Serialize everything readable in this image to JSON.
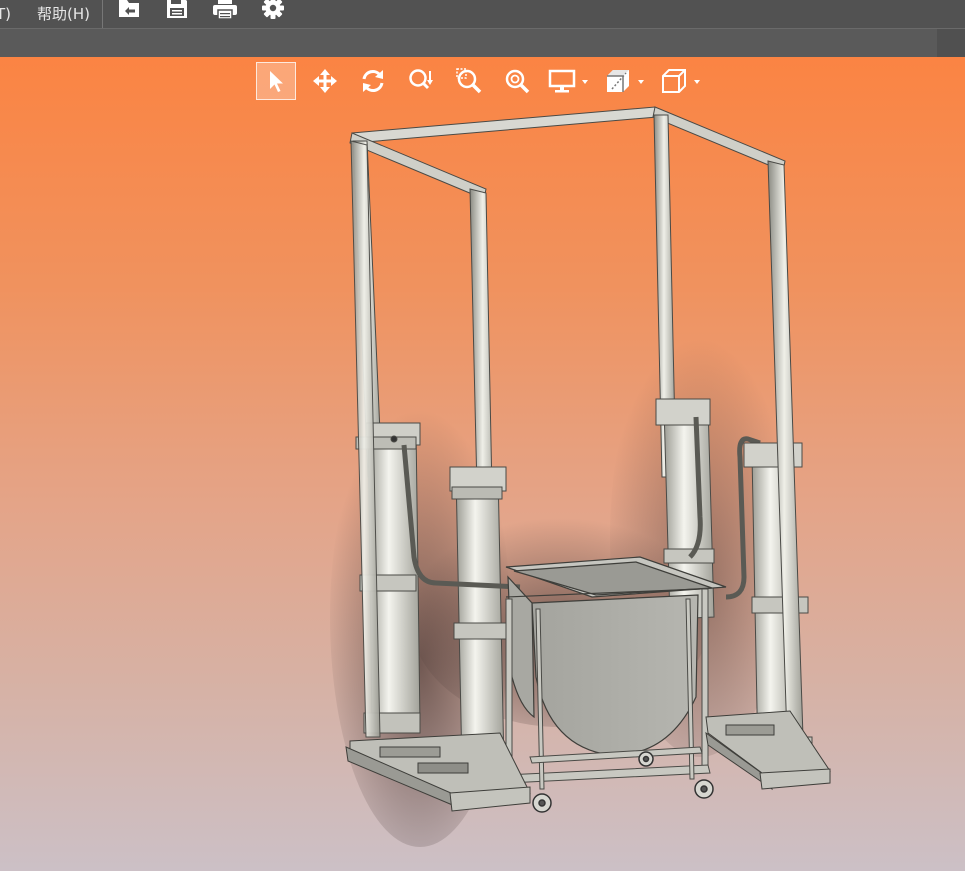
{
  "menubar": {
    "items": [
      {
        "label": "T)"
      },
      {
        "label": "帮助(H)"
      }
    ],
    "tools": [
      {
        "icon": "import-icon"
      },
      {
        "icon": "save-icon"
      },
      {
        "icon": "print-icon"
      },
      {
        "icon": "gear-icon"
      }
    ]
  },
  "view_toolbar": {
    "buttons": [
      {
        "icon": "select-arrow-icon",
        "active": true
      },
      {
        "icon": "pan-icon"
      },
      {
        "icon": "rotate-icon"
      },
      {
        "icon": "zoom-dynamic-icon"
      },
      {
        "icon": "zoom-window-icon"
      },
      {
        "icon": "zoom-fit-icon"
      },
      {
        "icon": "display-mode-icon",
        "dropdown": true
      },
      {
        "icon": "section-view-icon",
        "dropdown": true
      },
      {
        "icon": "standard-views-icon",
        "dropdown": true
      }
    ]
  },
  "viewport": {
    "background_top": "#fb8443",
    "background_bottom": "#ccc0c6",
    "model": "bucket-lift-frame-assembly"
  }
}
